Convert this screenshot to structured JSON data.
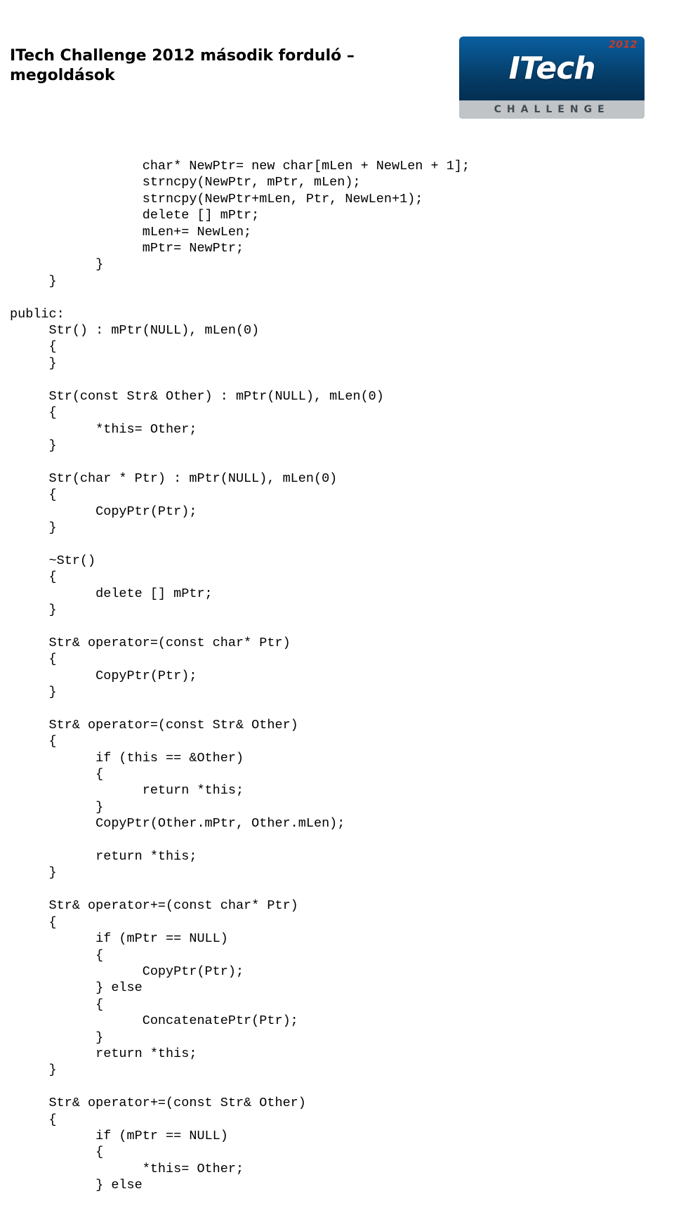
{
  "header": {
    "title": "ITech Challenge 2012 második forduló – megoldások",
    "logo": {
      "year": "2012",
      "word": "ITech",
      "bar": "CHALLENGE"
    }
  },
  "code_text": "                 char* NewPtr= new char[mLen + NewLen + 1];\n                 strncpy(NewPtr, mPtr, mLen);\n                 strncpy(NewPtr+mLen, Ptr, NewLen+1);\n                 delete [] mPtr;\n                 mLen+= NewLen;\n                 mPtr= NewPtr;\n           }\n     }\n\npublic:\n     Str() : mPtr(NULL), mLen(0)\n     {\n     }\n\n     Str(const Str& Other) : mPtr(NULL), mLen(0)\n     {\n           *this= Other;\n     }\n\n     Str(char * Ptr) : mPtr(NULL), mLen(0)\n     {\n           CopyPtr(Ptr);\n     }\n\n     ~Str()\n     {\n           delete [] mPtr;\n     }\n\n     Str& operator=(const char* Ptr)\n     {\n           CopyPtr(Ptr);\n     }\n\n     Str& operator=(const Str& Other)\n     {\n           if (this == &Other)\n           {\n                 return *this;\n           }\n           CopyPtr(Other.mPtr, Other.mLen);\n\n           return *this;\n     }\n\n     Str& operator+=(const char* Ptr)\n     {\n           if (mPtr == NULL)\n           {\n                 CopyPtr(Ptr);\n           } else\n           {\n                 ConcatenatePtr(Ptr);\n           }\n           return *this;\n     }\n\n     Str& operator+=(const Str& Other)\n     {\n           if (mPtr == NULL)\n           {\n                 *this= Other;\n           } else"
}
